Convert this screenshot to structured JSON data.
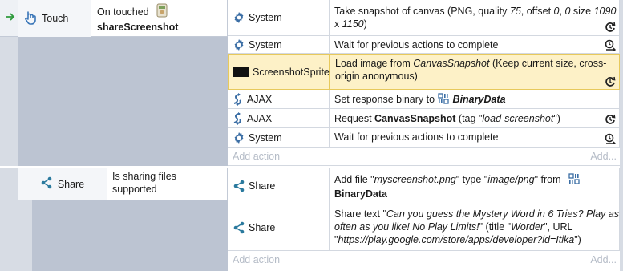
{
  "block1": {
    "trigger": {
      "object": "Touch",
      "line1": "On touched",
      "line2": "shareScreenshot"
    },
    "actions": [
      {
        "object": "System",
        "lines": [
          [
            {
              "t": "Take snapshot of canvas (PNG, quality "
            },
            {
              "t": "75",
              "i": true
            },
            {
              "t": ", offset "
            },
            {
              "t": "0",
              "i": true
            },
            {
              "t": ", "
            },
            {
              "t": "0",
              "i": true
            },
            {
              "t": " size "
            },
            {
              "t": "1090",
              "i": true
            }
          ],
          [
            {
              "t": "x "
            },
            {
              "t": "1150",
              "i": true
            },
            {
              "t": ")"
            }
          ]
        ],
        "right_icon": "async-icon"
      },
      {
        "object": "System",
        "lines": [
          [
            {
              "t": "Wait for previous actions to complete"
            }
          ]
        ],
        "right_icon": "wait-icon"
      },
      {
        "object": "ScreenshotSprite",
        "lines": [
          [
            {
              "t": "Load image from "
            },
            {
              "t": "CanvasSnapshot",
              "i": true
            },
            {
              "t": " (Keep current size, cross-"
            }
          ],
          [
            {
              "t": "origin anonymous)"
            }
          ]
        ],
        "right_icon": "async-icon"
      },
      {
        "object": "AJAX",
        "lines": [
          [
            {
              "t": "Set response binary to "
            },
            {
              "t": "BinaryData",
              "b": true,
              "i": true
            }
          ]
        ]
      },
      {
        "object": "AJAX",
        "lines": [
          [
            {
              "t": "Request "
            },
            {
              "t": "CanvasSnapshot",
              "b": true
            },
            {
              "t": " (tag \""
            },
            {
              "t": "load-screenshot",
              "i": true
            },
            {
              "t": "\")"
            }
          ]
        ],
        "right_icon": "async-icon"
      },
      {
        "object": "System",
        "lines": [
          [
            {
              "t": "Wait for previous actions to complete"
            }
          ]
        ],
        "right_icon": "wait-icon"
      }
    ],
    "add_action": "Add action",
    "add_more": "Add..."
  },
  "block2": {
    "condition": {
      "object": "Share",
      "line1": "Is sharing files",
      "line2": "supported"
    },
    "actions": [
      {
        "object": "Share",
        "lines": [
          [
            {
              "t": "Add file \""
            },
            {
              "t": "myscreenshot.png",
              "i": true
            },
            {
              "t": "\" type \""
            },
            {
              "t": "image/png",
              "i": true
            },
            {
              "t": "\" from "
            }
          ],
          [
            {
              "t": "BinaryData",
              "b": true
            }
          ]
        ]
      },
      {
        "object": "Share",
        "lines": [
          [
            {
              "t": "Share text \""
            },
            {
              "t": "Can you guess the Mystery Word in 6 Tries? Play as",
              "i": true
            }
          ],
          [
            {
              "t": "often as you like! No Play Limits!",
              "i": true
            },
            {
              "t": "\" (title \""
            },
            {
              "t": "Worder",
              "i": true
            },
            {
              "t": "\", URL"
            }
          ],
          [
            {
              "t": "\""
            },
            {
              "t": "https://play.google.com/store/apps/developer?id=Itika",
              "i": true
            },
            {
              "t": "\")"
            }
          ]
        ]
      }
    ],
    "add_action": "Add action",
    "add_more": "Add..."
  },
  "colors": {
    "system": "#3b6ea5",
    "ajax": "#3b6ea5",
    "share": "#2b7a9e",
    "touch": "#3a76b8",
    "highlight": "#fdf1c7",
    "arrow": "#2e9a3c"
  }
}
